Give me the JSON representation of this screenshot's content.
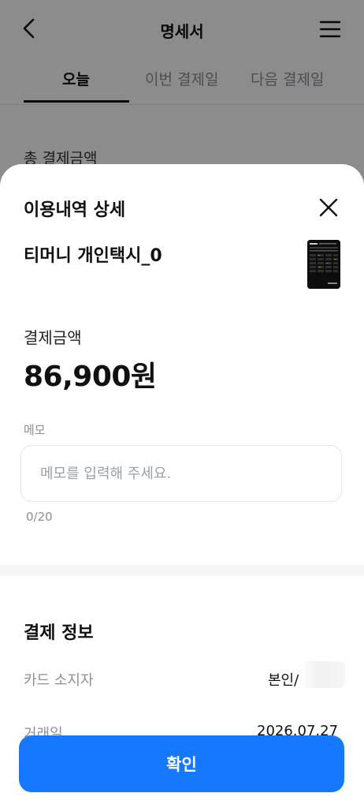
{
  "header": {
    "title": "명세서",
    "back_icon": "chevron-left-icon",
    "menu_icon": "hamburger-menu-icon"
  },
  "tabs": [
    {
      "label": "오늘",
      "active": true
    },
    {
      "label": "이번 결제일",
      "active": false
    },
    {
      "label": "다음 결제일",
      "active": false
    }
  ],
  "background": {
    "total_label": "총 결제금액"
  },
  "sheet": {
    "title": "이용내역 상세",
    "close_icon": "close-icon",
    "merchant": "티머니 개인택시_0",
    "amount_label": "결제금액",
    "amount_value": "86,900원",
    "memo": {
      "label": "메모",
      "placeholder": "메모를 입력해 주세요.",
      "value": "",
      "counter": "0/20"
    },
    "payment_info": {
      "title": "결제 정보",
      "rows": [
        {
          "label": "카드 소지자",
          "value": "본인/"
        },
        {
          "label": "거래일",
          "value": "2026.07.27"
        }
      ]
    },
    "confirm_label": "확인"
  },
  "colors": {
    "accent": "#1677ff",
    "overlay": "rgba(0,0,0,0.45)",
    "muted_text": "#8a8f98"
  }
}
